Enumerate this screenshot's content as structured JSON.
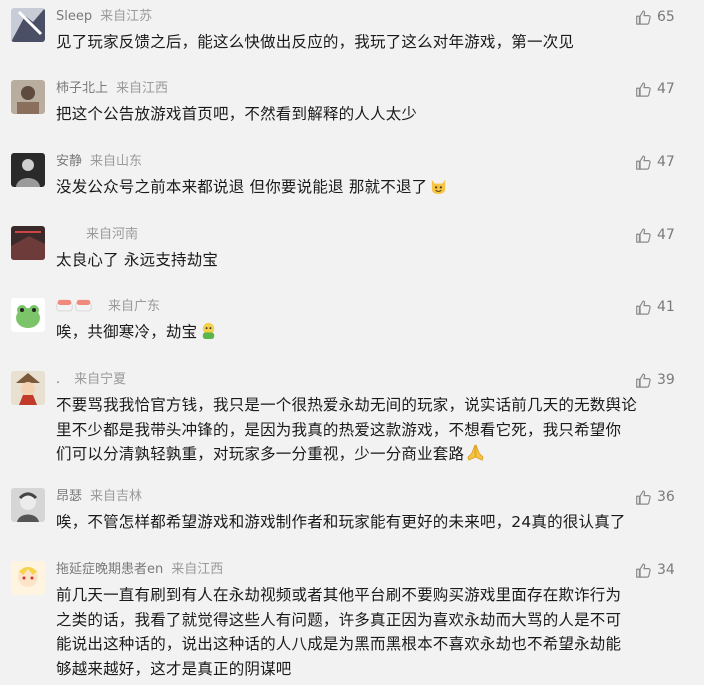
{
  "comments": [
    {
      "nick": "Sleep",
      "location": "来自江苏",
      "text": "见了玩家反馈之后，能这么快做出反应的，我玩了这么对年游戏，第一次见",
      "likes": "65"
    },
    {
      "nick": "柿子北上",
      "location": "来自江西",
      "text": "把这个公告放游戏首页吧，不然看到解释的人人太少",
      "likes": "47"
    },
    {
      "nick": "安静",
      "location": "来自山东",
      "text": "没发公众号之前本来都说退 但你要说能退 那就不退了",
      "likes": "47"
    },
    {
      "nick": "",
      "location": "来自河南",
      "text": "太良心了 永远支持劫宝",
      "likes": "47"
    },
    {
      "nick": "",
      "location": "来自广东",
      "text": "唉，共御寒冷，劫宝",
      "likes": "41"
    },
    {
      "nick": ".",
      "location": "来自宁夏",
      "lines": [
        "不要骂我我恰官方钱，我只是一个很热爱永劫无间的玩家，说实话前几天的无数舆论",
        "里不少都是我带头冲锋的，是因为我真的热爱这款游戏，不想看它死，我只希望你",
        "们可以分清孰轻孰重，对玩家多一分重视，少一分商业套路"
      ],
      "likes": "39"
    },
    {
      "nick": "昂瑟",
      "location": "来自吉林",
      "text": "唉，不管怎样都希望游戏和游戏制作者和玩家能有更好的未来吧，24真的很认真了",
      "likes": "36"
    },
    {
      "nick": "拖延症晚期患者en",
      "location": "来自江西",
      "lines": [
        "前几天一直有刷到有人在永劫视频或者其他平台刷不要购买游戏里面存在欺诈行为",
        "之类的话，我看了就觉得这些人有问题，许多真正因为喜欢永劫而大骂的人是不可",
        "能说出这种话的，说出这种话的人八成是为黑而黑根本不喜欢永劫也不希望永劫能",
        "够越来越好，这才是真正的阴谋吧"
      ],
      "likes": "34"
    }
  ],
  "icons": {
    "like": "thumbs-up-icon",
    "emoji_cat": "grinning-cat-emoji",
    "emoji_bag": "green-mascot-emoji",
    "emoji_sushi": "sushi-icon",
    "emoji_pray": "praying-hands-emoji"
  },
  "colors": {
    "background": "#f2f2f2",
    "text": "#1a1a1a",
    "meta": "#8a8a8a"
  }
}
